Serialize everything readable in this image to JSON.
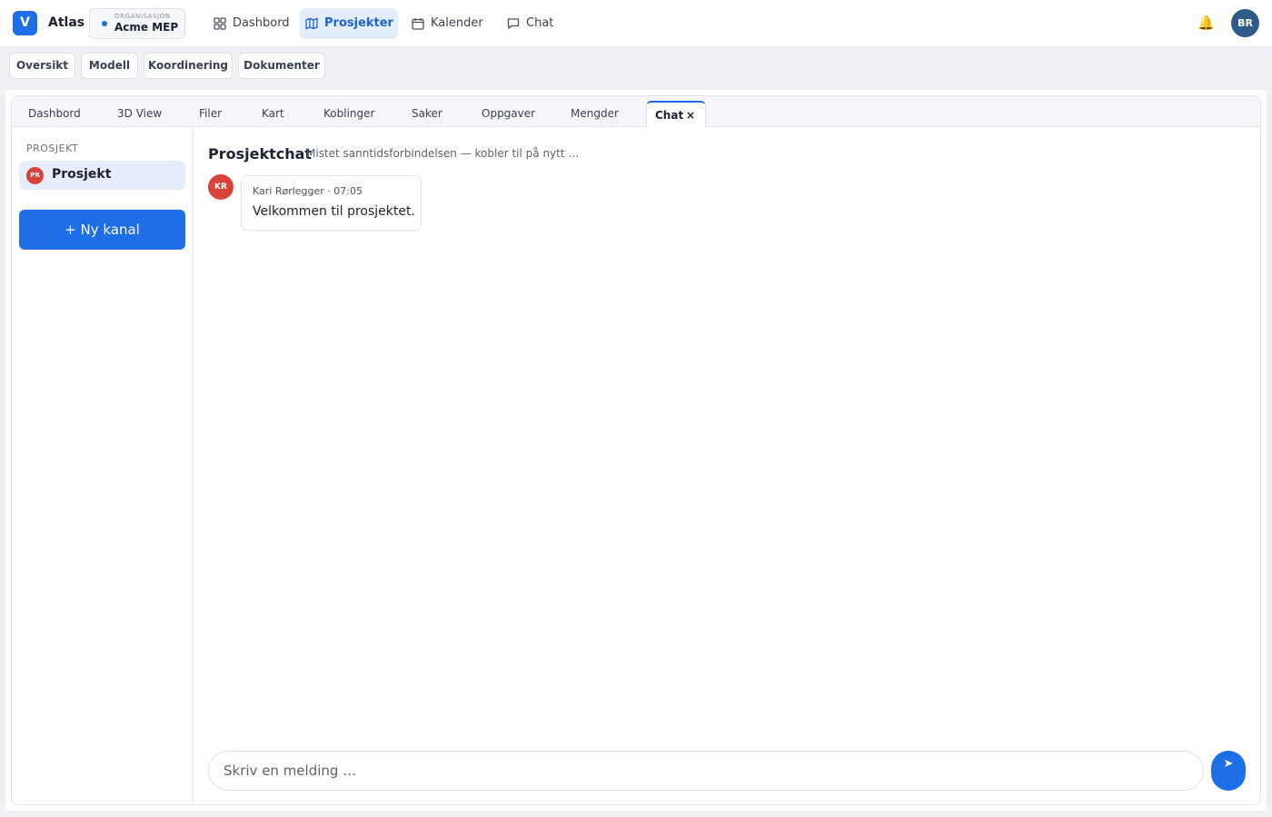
{
  "app": {
    "logo_letter": "V",
    "name": "Atlas"
  },
  "org": {
    "label": "ORGANISASJON",
    "name": "Acme MEP"
  },
  "nav": [
    {
      "label": "Dashbord",
      "icon": "grid-icon",
      "active": false
    },
    {
      "label": "Prosjekter",
      "icon": "map-icon",
      "active": true
    },
    {
      "label": "Kalender",
      "icon": "calendar-icon",
      "active": false
    },
    {
      "label": "Chat",
      "icon": "chat-icon",
      "active": false
    }
  ],
  "user": {
    "initials": "BR",
    "bell": "🔔"
  },
  "subnav": [
    "Oversikt",
    "Modell",
    "Koordinering",
    "Dokumenter"
  ],
  "tabs": [
    {
      "label": "Dashbord"
    },
    {
      "label": "3D View"
    },
    {
      "label": "Filer"
    },
    {
      "label": "Kart"
    },
    {
      "label": "Koblinger"
    },
    {
      "label": "Saker"
    },
    {
      "label": "Oppgaver"
    },
    {
      "label": "Mengder"
    },
    {
      "label": "Chat",
      "close": "×",
      "active": true
    }
  ],
  "sidebar": {
    "heading": "PROSJEKT",
    "channels": [
      {
        "initials": "PR",
        "name": "Prosjekt",
        "active": true
      }
    ],
    "new_channel_label": "+ Ny kanal"
  },
  "chat": {
    "title": "Prosjektchat",
    "status": "Mistet sanntidsforbindelsen — kobler til på nytt …",
    "messages": [
      {
        "initials": "KR",
        "meta": "Kari Rørlegger · 07:05",
        "text": "Velkommen til prosjektet."
      }
    ],
    "composer_placeholder": "Skriv en melding …",
    "send_glyph": "➤"
  },
  "colors": {
    "accent": "#1e6ee8",
    "avatar_red": "#d94238",
    "user_avatar": "#2f5a8a"
  }
}
